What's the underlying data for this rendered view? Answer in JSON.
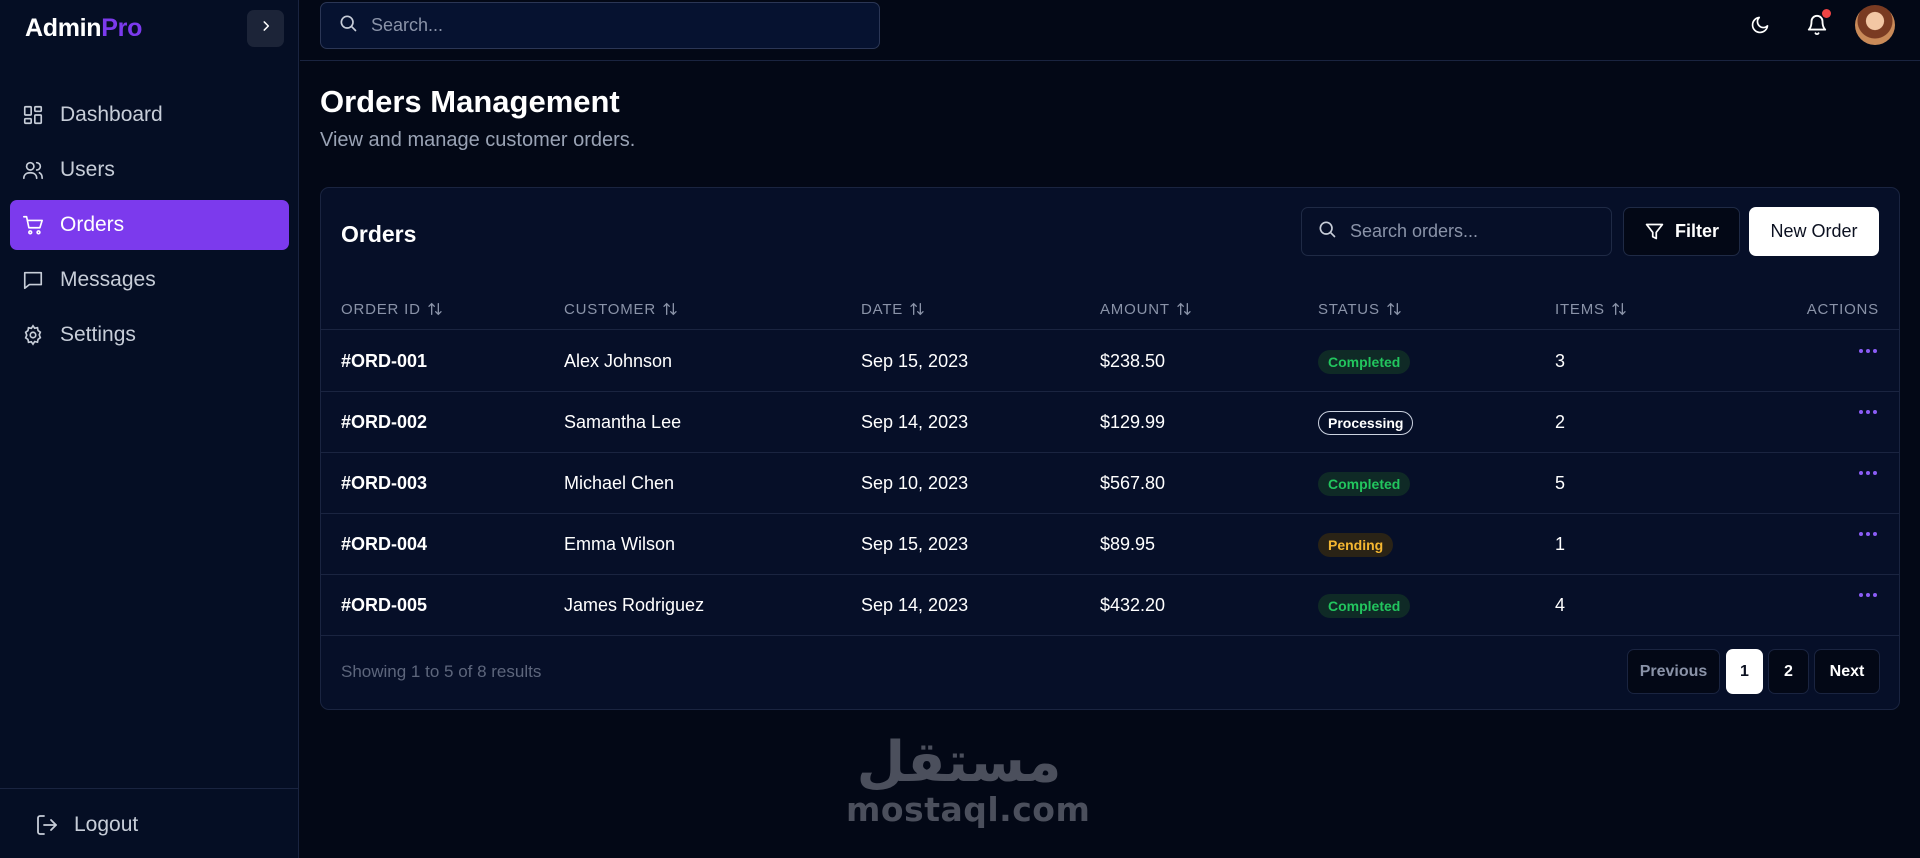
{
  "brand": {
    "name_a": "Admin",
    "name_b": "Pro",
    "accent_color": "#7c3aed"
  },
  "sidebar": {
    "items": [
      {
        "label": "Dashboard",
        "icon": "dashboard-icon"
      },
      {
        "label": "Users",
        "icon": "users-icon"
      },
      {
        "label": "Orders",
        "icon": "cart-icon",
        "active": true
      },
      {
        "label": "Messages",
        "icon": "message-icon"
      },
      {
        "label": "Settings",
        "icon": "gear-icon"
      }
    ],
    "logout_label": "Logout"
  },
  "topbar": {
    "search_placeholder": "Search...",
    "icons": [
      "moon-icon",
      "bell-icon",
      "avatar"
    ]
  },
  "page": {
    "title": "Orders Management",
    "subtitle": "View and manage customer orders."
  },
  "orders": {
    "card_title": "Orders",
    "search_placeholder": "Search orders...",
    "filter_label": "Filter",
    "new_order_label": "New Order",
    "columns": [
      "ORDER ID",
      "CUSTOMER",
      "DATE",
      "AMOUNT",
      "STATUS",
      "ITEMS",
      "ACTIONS"
    ],
    "rows": [
      {
        "id": "#ORD-001",
        "customer": "Alex Johnson",
        "date": "Sep 15, 2023",
        "amount": "$238.50",
        "status": "Completed",
        "items": "3"
      },
      {
        "id": "#ORD-002",
        "customer": "Samantha Lee",
        "date": "Sep 14, 2023",
        "amount": "$129.99",
        "status": "Processing",
        "items": "2"
      },
      {
        "id": "#ORD-003",
        "customer": "Michael Chen",
        "date": "Sep 10, 2023",
        "amount": "$567.80",
        "status": "Completed",
        "items": "5"
      },
      {
        "id": "#ORD-004",
        "customer": "Emma Wilson",
        "date": "Sep 15, 2023",
        "amount": "$89.95",
        "status": "Pending",
        "items": "1"
      },
      {
        "id": "#ORD-005",
        "customer": "James Rodriguez",
        "date": "Sep 14, 2023",
        "amount": "$432.20",
        "status": "Completed",
        "items": "4"
      }
    ],
    "results_text": "Showing 1 to 5 of 8 results",
    "pagination": {
      "previous": "Previous",
      "pages": [
        "1",
        "2"
      ],
      "current": "1",
      "next": "Next"
    },
    "status_colors": {
      "Completed": "#22c55e",
      "Processing": "#ffffff",
      "Pending": "#f5b731"
    }
  },
  "watermark": {
    "arabic": "مستقل",
    "latin": "mostaql.com"
  }
}
